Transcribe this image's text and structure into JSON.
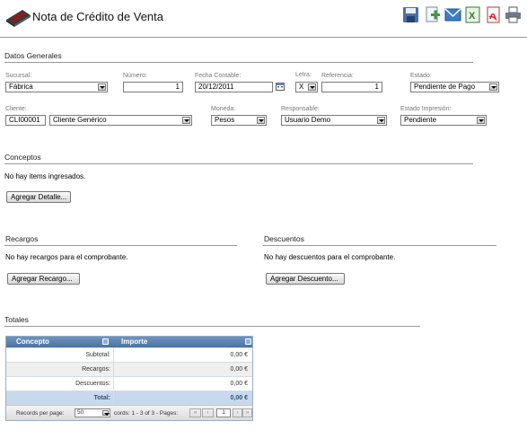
{
  "header": {
    "title": "Nota de Crédito de Venta",
    "toolbar": [
      "save-icon",
      "add-document-icon",
      "email-icon",
      "excel-icon",
      "pdf-icon",
      "print-icon"
    ]
  },
  "general": {
    "section_title": "Datos Generales",
    "sucursal": {
      "label": "Sucursal:",
      "value": "Fábrica"
    },
    "numero": {
      "label": "Número:",
      "value": "1"
    },
    "fecha": {
      "label": "Fecha Contable:",
      "value": "20/12/2011"
    },
    "letra": {
      "label": "Letra:",
      "value": "X"
    },
    "referencia": {
      "label": "Referencia:",
      "value": "1"
    },
    "estado": {
      "label": "Estado:",
      "value": "Pendiente de Pago"
    },
    "cliente": {
      "label": "Cliente:",
      "code": "CLI00001",
      "name": "Cliente Genérico"
    },
    "moneda": {
      "label": "Moneda:",
      "value": "Pesos"
    },
    "responsable": {
      "label": "Responsable:",
      "value": "Usuario Demo"
    },
    "estado_impresion": {
      "label": "Estado Impresión:",
      "value": "Pendiente"
    }
  },
  "conceptos": {
    "section_title": "Conceptos",
    "empty": "No hay items ingresados.",
    "button": "Agregar Detalle..."
  },
  "recargos": {
    "section_title": "Recargos",
    "empty": "No hay recargos para el comprobante.",
    "button": "Agregar Recargo..."
  },
  "descuentos": {
    "section_title": "Descuentos",
    "empty": "No hay descuentos para el comprobante.",
    "button": "Agregar Descuento..."
  },
  "totales": {
    "section_title": "Totales",
    "columns": [
      "Concepto",
      "Importe"
    ],
    "rows": [
      {
        "concepto": "Subtotal:",
        "importe": "0,00 €"
      },
      {
        "concepto": "Recargos:",
        "importe": "0,00 €"
      },
      {
        "concepto": "Descuentos:",
        "importe": "0,00 €"
      },
      {
        "concepto": "Total:",
        "importe": "0,00 €"
      }
    ],
    "footer": {
      "per_page_label": "Records per page:",
      "per_page_value": "50",
      "records": "cords: 1 - 3 of 3 - Pages:",
      "page": "1"
    }
  }
}
